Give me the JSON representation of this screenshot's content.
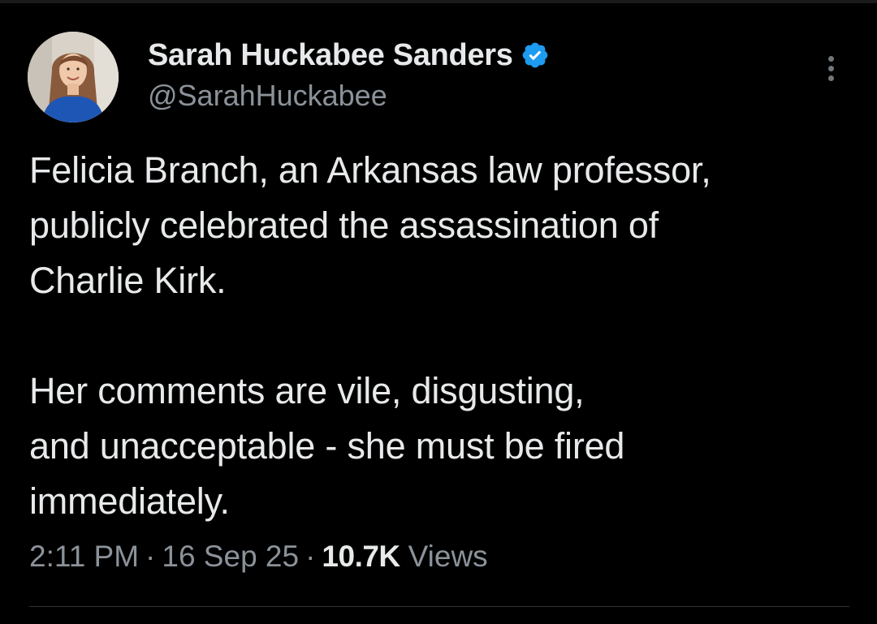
{
  "author": {
    "display_name": "Sarah Huckabee Sanders",
    "handle": "@SarahHuckabee",
    "verified_icon": "verified-badge-icon",
    "avatar_icon": "profile-photo"
  },
  "tweet": {
    "paragraphs": [
      "Felicia Branch, an Arkansas law professor,\npublicly celebrated the assassination of\nCharlie Kirk.",
      "Her comments are vile, disgusting,\nand unacceptable - she must be fired\nimmediately."
    ]
  },
  "meta": {
    "time": "2:11 PM",
    "separator": "·",
    "date": "16 Sep 25",
    "views_count": "10.7K",
    "views_label": "Views"
  },
  "more_icon": "more-vertical-icon",
  "colors": {
    "background": "#000000",
    "primary_text": "#e7e9ea",
    "secondary_text": "#8b9299",
    "verified_blue": "#1d9bf0"
  }
}
